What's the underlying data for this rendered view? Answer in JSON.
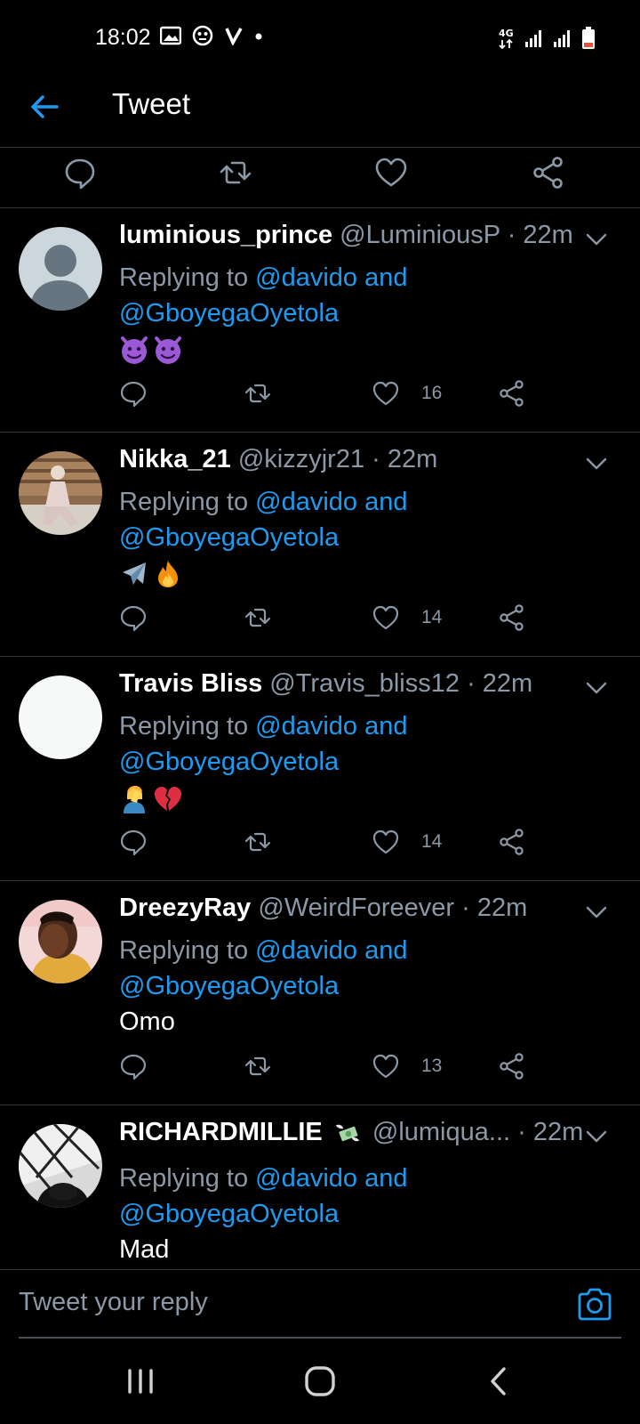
{
  "status_bar": {
    "time": "18:02",
    "network": "4G",
    "icons_left": [
      "gallery-icon",
      "face-icon",
      "v-icon",
      "dot-icon"
    ],
    "icons_right": [
      "4g-icon",
      "signal-icon",
      "signal-icon",
      "battery-icon"
    ]
  },
  "header": {
    "title": "Tweet",
    "accent": "#1d9bf0"
  },
  "replies": [
    {
      "display_name": "luminious_prince",
      "handle": "@LuminiousP",
      "time": "22m",
      "replying_prefix": "Replying to ",
      "mention_1": "@davido and",
      "mention_2": "@GboyegaOyetola",
      "body": "",
      "emojis": [
        "smiling-imp",
        "smiling-imp"
      ],
      "likes": "16",
      "avatar": "default-avatar"
    },
    {
      "display_name": "Nikka_21",
      "handle": "@kizzyjr21",
      "time": "22m",
      "replying_prefix": "Replying to ",
      "mention_1": "@davido and",
      "mention_2": "@GboyegaOyetola",
      "body": "",
      "emojis": [
        "airplane",
        "fire"
      ],
      "likes": "14",
      "avatar": "photo-avatar"
    },
    {
      "display_name": "Travis Bliss",
      "handle": "@Travis_bliss12",
      "time": "22m",
      "replying_prefix": "Replying to ",
      "mention_1": "@davido and",
      "mention_2": "@GboyegaOyetola",
      "body": "",
      "emojis": [
        "facepalm",
        "broken-heart"
      ],
      "likes": "14",
      "avatar": "blank-avatar"
    },
    {
      "display_name": "DreezyRay",
      "handle": "@WeirdForeever",
      "time": "22m",
      "replying_prefix": "Replying to ",
      "mention_1": "@davido and",
      "mention_2": "@GboyegaOyetola",
      "body": "Omo",
      "emojis": [],
      "likes": "13",
      "avatar": "photo-avatar"
    },
    {
      "display_name": "RICHARDMILLIE",
      "handle": "@lumiqua...",
      "time": "22m",
      "replying_prefix": "Replying to ",
      "mention_1": "@davido and",
      "mention_2": "@GboyegaOyetola",
      "body": "Mad",
      "emojis": [],
      "name_emoji": "money-with-wings",
      "likes": "",
      "avatar": "photo-avatar"
    }
  ],
  "composer": {
    "placeholder": "Tweet your reply"
  },
  "colors": {
    "background": "#000000",
    "link": "#1d9bf0",
    "muted": "#8b98a5",
    "divider": "#2f3336"
  }
}
